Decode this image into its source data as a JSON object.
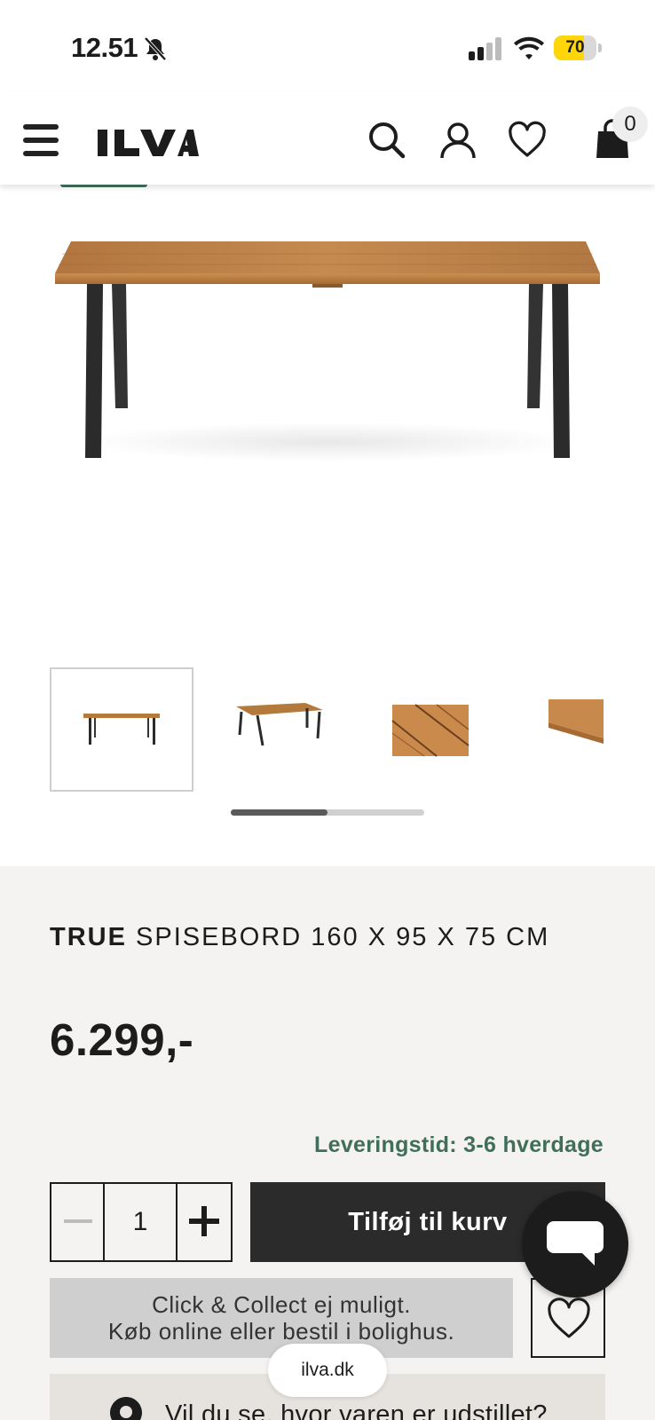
{
  "status_bar": {
    "time": "12.51",
    "battery_level": "70",
    "battery_fraction": 0.7,
    "icons": [
      "bell-slash-icon",
      "cellular-signal-icon",
      "wifi-icon",
      "battery-icon"
    ]
  },
  "header": {
    "logo": "ILVA",
    "icons": [
      "menu-icon",
      "search-icon",
      "account-icon",
      "heart-icon",
      "shopping-bag-icon"
    ],
    "cart_count": "0"
  },
  "gallery": {
    "thumbnails": [
      "table-front",
      "table-angled",
      "wood-detail",
      "wood-edge"
    ],
    "active_index": 0,
    "scroll_position": 0.5,
    "colors": {
      "wood": "#b47a3c",
      "legs": "#2b2b2b"
    }
  },
  "product": {
    "brand": "TRUE",
    "name": "SPISEBORD 160 X 95 X 75 CM",
    "price": "6.299,-",
    "delivery": "Leveringstid: 3-6 hverdage",
    "quantity": "1",
    "add_to_cart_label": "Tilføj til kurv",
    "click_collect_line1": "Click & Collect ej muligt.",
    "click_collect_line2": "Køb online eller bestil i bolighus.",
    "showroom_text": "Vil du se, hvor varen er udstillet?"
  },
  "browser": {
    "url": "ilva.dk"
  },
  "colors": {
    "accent_green": "#3f6f5a",
    "dark": "#2b2b2b",
    "section_bg": "#f4f3f1"
  }
}
